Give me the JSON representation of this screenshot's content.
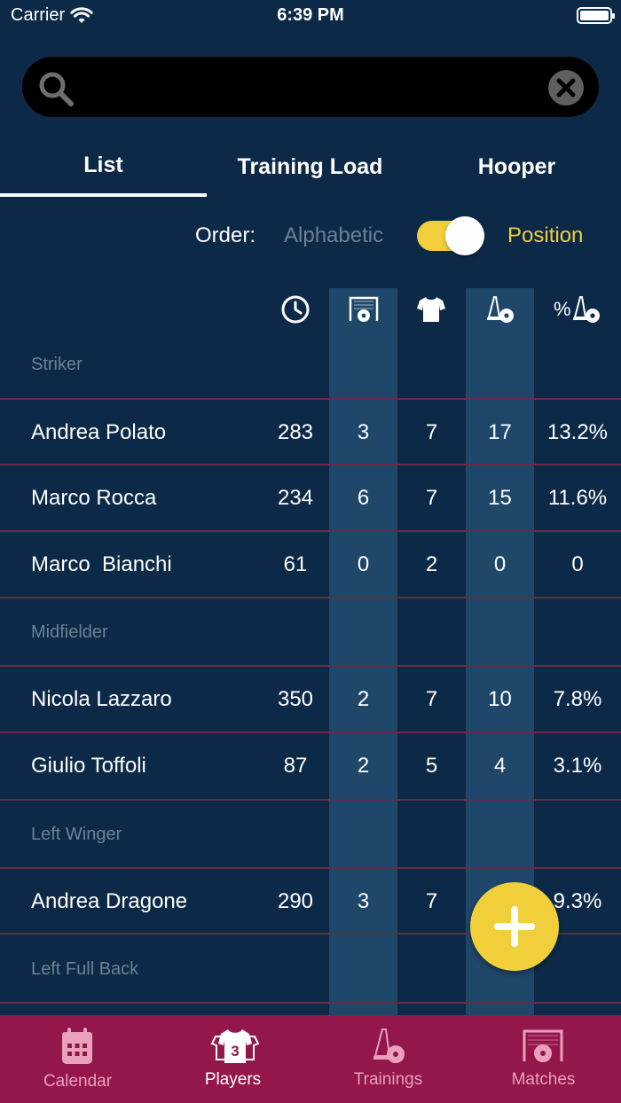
{
  "status": {
    "carrier": "Carrier",
    "time": "6:39 PM"
  },
  "search": {
    "placeholder": "",
    "value": ""
  },
  "tabs": [
    {
      "label": "List",
      "active": true
    },
    {
      "label": "Training Load",
      "active": false
    },
    {
      "label": "Hooper",
      "active": false
    }
  ],
  "order": {
    "label": "Order:",
    "option_off": "Alphabetic",
    "option_on": "Position",
    "toggle_on": true
  },
  "table": {
    "columns": [
      {
        "icon": "clock-icon"
      },
      {
        "icon": "goal-icon"
      },
      {
        "icon": "shirt-icon"
      },
      {
        "icon": "cone-ball-icon"
      },
      {
        "prefix": "%",
        "icon": "cone-ball-icon"
      }
    ],
    "groups": [
      {
        "position": "Striker",
        "players": [
          {
            "name": "Andrea Polato",
            "values": [
              "283",
              "3",
              "7",
              "17",
              "13.2%"
            ]
          },
          {
            "name": "Marco Rocca",
            "values": [
              "234",
              "6",
              "7",
              "15",
              "11.6%"
            ]
          },
          {
            "name": "Marco  Bianchi",
            "values": [
              "61",
              "0",
              "2",
              "0",
              "0"
            ]
          }
        ]
      },
      {
        "position": "Midfielder",
        "players": [
          {
            "name": "Nicola Lazzaro",
            "values": [
              "350",
              "2",
              "7",
              "10",
              "7.8%"
            ]
          },
          {
            "name": "Giulio Toffoli",
            "values": [
              "87",
              "2",
              "5",
              "4",
              "3.1%"
            ]
          }
        ]
      },
      {
        "position": "Left Winger",
        "players": [
          {
            "name": "Andrea Dragone",
            "values": [
              "290",
              "3",
              "7",
              "",
              "9.3%"
            ]
          }
        ]
      },
      {
        "position": "Left Full Back",
        "players": []
      }
    ]
  },
  "tabbar": [
    {
      "label": "Calendar",
      "icon": "calendar-icon",
      "active": false
    },
    {
      "label": "Players",
      "icon": "players-icon",
      "badge": "3",
      "active": true
    },
    {
      "label": "Trainings",
      "icon": "cone-ball-icon",
      "active": false
    },
    {
      "label": "Matches",
      "icon": "goal-icon",
      "active": false
    }
  ],
  "colors": {
    "background": "#0c2a47",
    "stripe": "#1e4769",
    "accent": "#f0cf3a",
    "divider": "#6a2a47",
    "tabbar": "#94174b",
    "muted_text": "#6e8094"
  }
}
